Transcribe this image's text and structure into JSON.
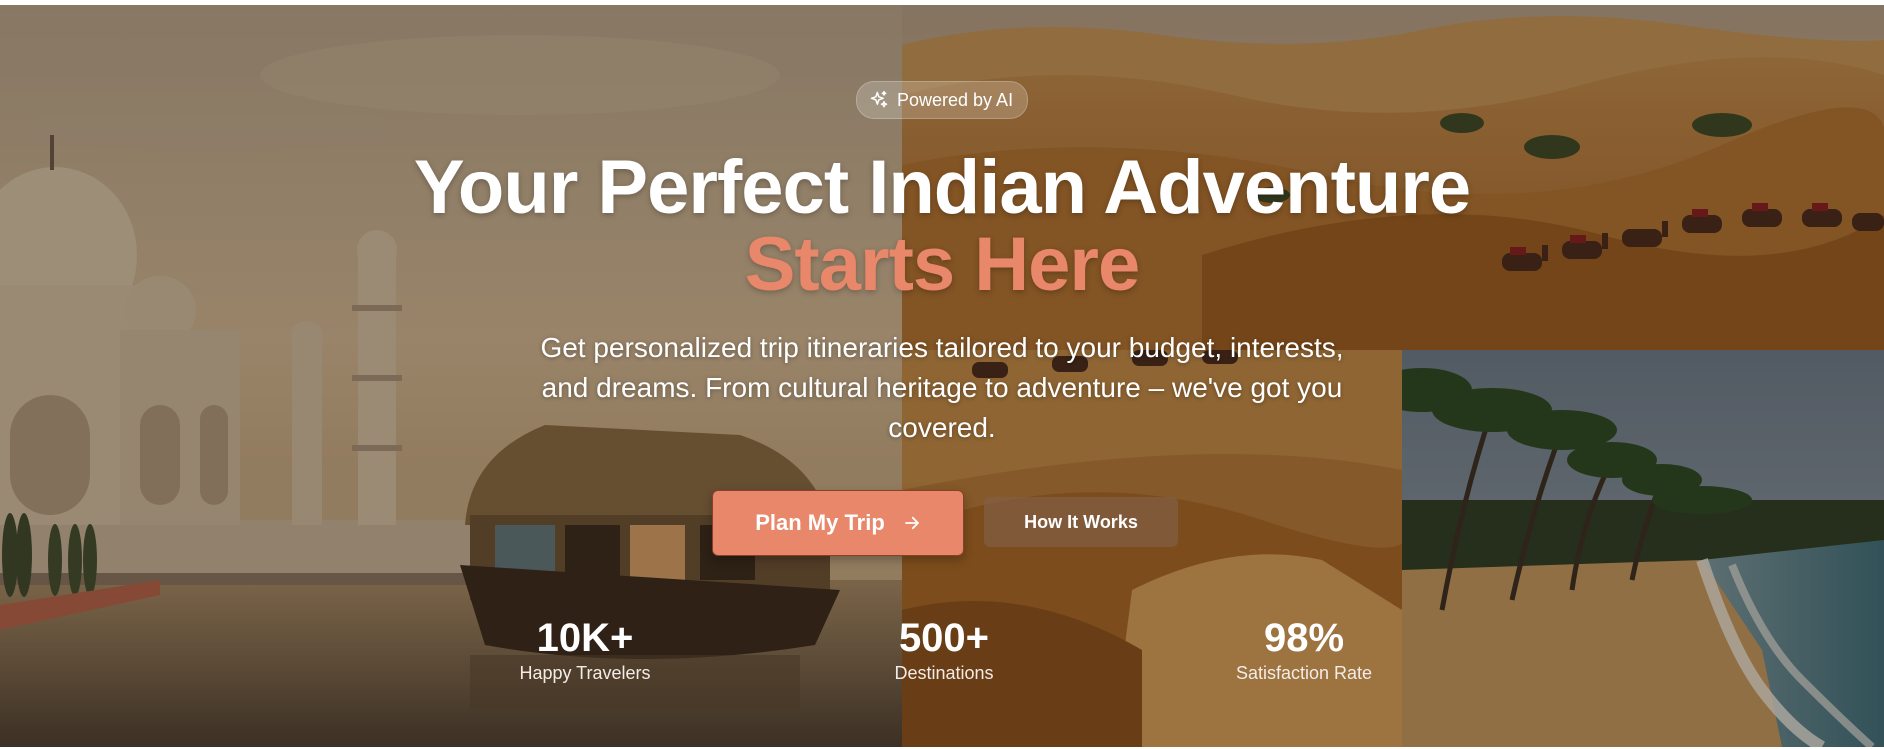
{
  "badge": {
    "icon": "sparkles-icon",
    "label": "Powered by AI"
  },
  "headline": {
    "line1": "Your Perfect Indian Adventure",
    "line2": "Starts Here",
    "accent_color": "#e8876a"
  },
  "subtitle": "Get personalized trip itineraries tailored to your budget, interests, and dreams. From cultural heritage to adventure – we've got you covered.",
  "buttons": {
    "primary_label": "Plan My Trip",
    "primary_icon": "arrow-right-icon",
    "secondary_label": "How It Works"
  },
  "stats": [
    {
      "value": "10K+",
      "label": "Happy Travelers"
    },
    {
      "value": "500+",
      "label": "Destinations"
    },
    {
      "value": "98%",
      "label": "Satisfaction Rate"
    }
  ]
}
